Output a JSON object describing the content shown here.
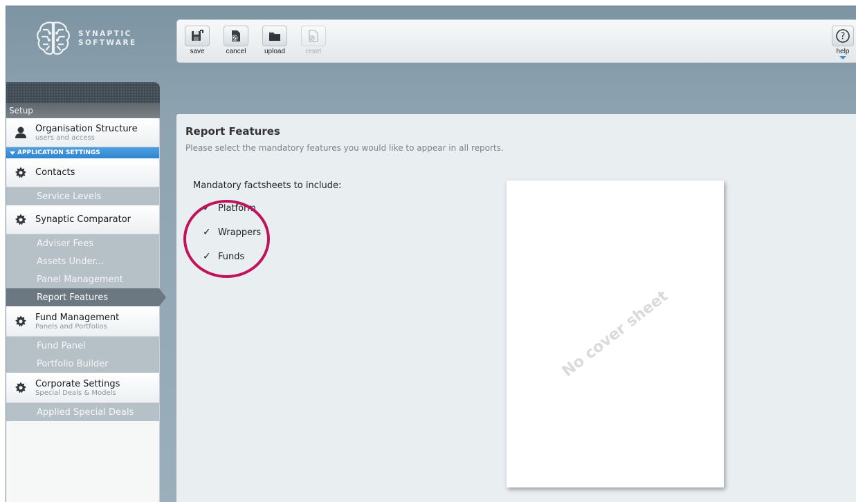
{
  "brand": {
    "line1": "SYNAPTIC",
    "line2": "SOFTWARE"
  },
  "toolbar": {
    "buttons": [
      {
        "label": "save",
        "icon": "save-icon",
        "enabled": true
      },
      {
        "label": "cancel",
        "icon": "cancel-icon",
        "enabled": true
      },
      {
        "label": "upload",
        "icon": "upload-icon",
        "enabled": true
      },
      {
        "label": "reset",
        "icon": "reset-icon",
        "enabled": false
      }
    ],
    "help": {
      "label": "help",
      "glyph": "?"
    }
  },
  "sidebar": {
    "header": "Setup",
    "section_label": "APPLICATION SETTINGS",
    "items": [
      {
        "label": "Organisation Structure",
        "sub": "users and access",
        "icon": "user-icon"
      },
      {
        "label": "Contacts",
        "icon": "gear-icon"
      },
      {
        "label": "Service Levels"
      },
      {
        "label": "Synaptic Comparator",
        "icon": "gear-icon"
      },
      {
        "label": "Adviser Fees"
      },
      {
        "label": "Assets Under..."
      },
      {
        "label": "Panel Management"
      },
      {
        "label": "Report Features",
        "active": true
      },
      {
        "label": "Fund Management",
        "sub": "Panels and Portfolios",
        "icon": "gear-icon"
      },
      {
        "label": "Fund Panel"
      },
      {
        "label": "Portfolio Builder"
      },
      {
        "label": "Corporate Settings",
        "sub": "Special Deals & Models",
        "icon": "gear-icon"
      },
      {
        "label": "Applied Special Deals"
      }
    ]
  },
  "main": {
    "title": "Report Features",
    "subtitle": "Please select the mandatory features you would like to appear in all reports.",
    "mandatory_label": "Mandatory factsheets to include:",
    "checkboxes": [
      {
        "label": "Platform",
        "checked": true,
        "mark": "✓"
      },
      {
        "label": "Wrappers",
        "checked": true,
        "mark": "✓"
      },
      {
        "label": "Funds",
        "checked": true,
        "mark": "✓"
      }
    ],
    "cover_text": "No cover sheet"
  },
  "colors": {
    "accent": "#2f84cf",
    "highlight_circle": "#c0135c",
    "active_nav": "#6b7882"
  }
}
